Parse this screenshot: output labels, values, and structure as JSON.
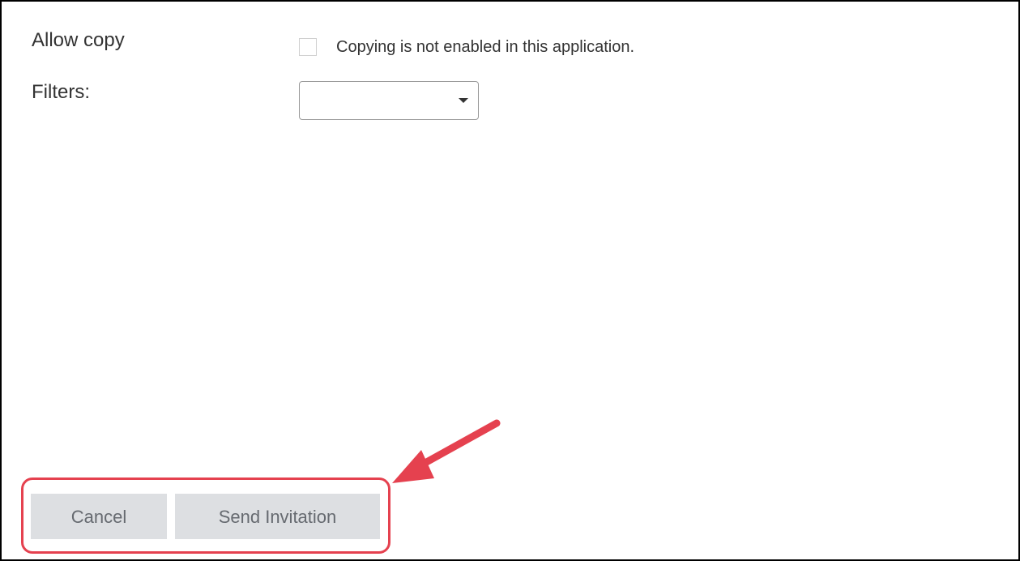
{
  "form": {
    "allow_copy_label": "Allow copy",
    "allow_copy_checked": false,
    "allow_copy_note": "Copying is not enabled in this application.",
    "filters_label": "Filters:",
    "filters_selected": ""
  },
  "actions": {
    "cancel_label": "Cancel",
    "send_label": "Send Invitation"
  },
  "annotation": {
    "highlight_color": "#e5414f",
    "icon": "arrow-pointer-icon"
  },
  "colors": {
    "button_bg": "#dddfe2",
    "button_text": "#666a70",
    "text": "#333333"
  }
}
